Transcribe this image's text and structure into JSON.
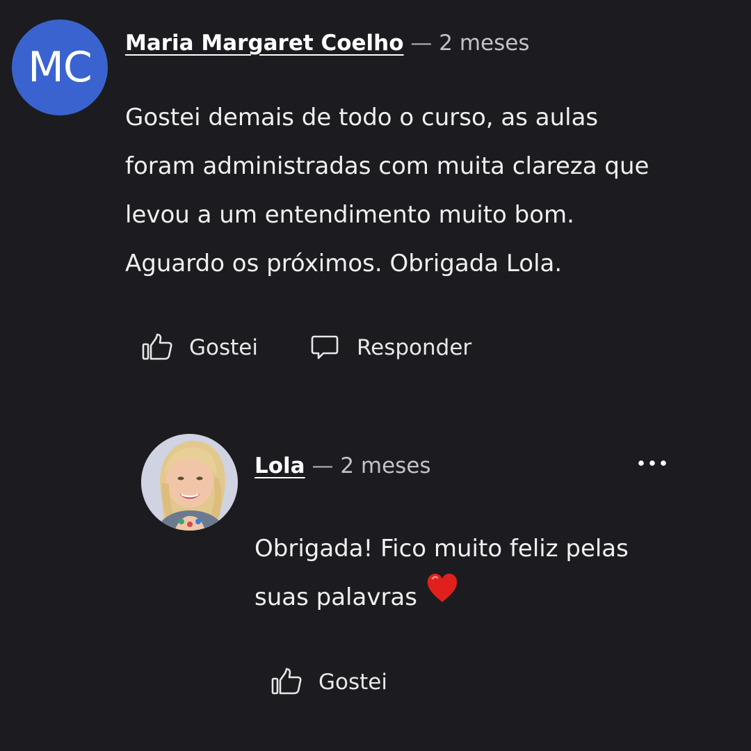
{
  "comment": {
    "avatar_initials": "MC",
    "avatar_color": "#3a63cf",
    "author": "Maria Margaret Coelho",
    "separator": "—",
    "time": "2 meses",
    "lines": [
      "Gostei demais de todo o curso, as aulas",
      "foram administradas com muita clareza que",
      "levou a um entendimento muito bom.",
      "Aguardo os próximos. Obrigada Lola."
    ],
    "actions": {
      "like_label": "Gostei",
      "reply_label": "Responder"
    }
  },
  "reply": {
    "author": "Lola",
    "separator": "—",
    "time": "2 meses",
    "lines": [
      "Obrigada! Fico muito feliz pelas",
      "suas palavras"
    ],
    "emoji": "heart-emoji",
    "actions": {
      "like_label": "Gostei"
    },
    "more_icon": "more-horizontal-icon"
  },
  "colors": {
    "background": "#1c1c20",
    "text": "#f0f0f0",
    "muted": "#a8a8ae",
    "heart": "#e0201d"
  }
}
